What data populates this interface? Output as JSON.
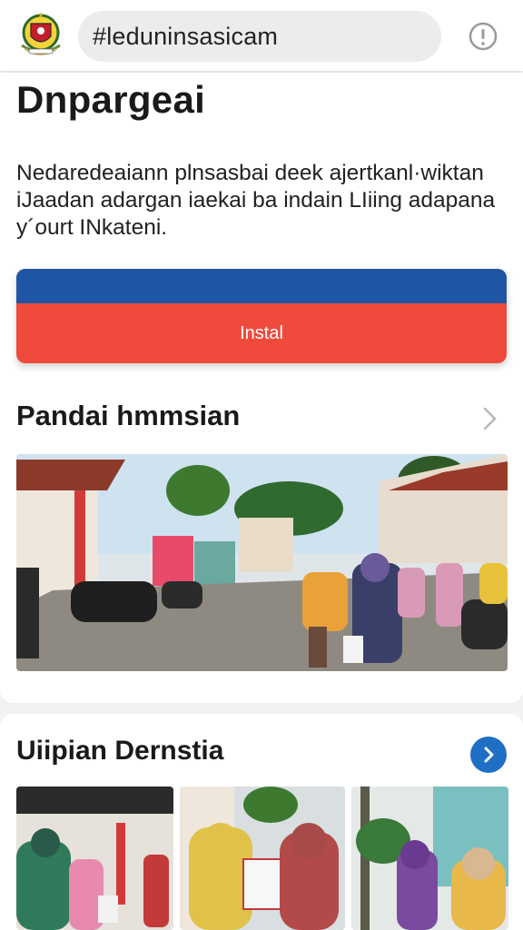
{
  "header": {
    "logo_icon": "emblem-logo-icon",
    "search_value": "#leduninsasicam",
    "info_icon": "info-circle-icon"
  },
  "app": {
    "title": "Dnpargeai",
    "description": "Nedaredeaiann plnsasbai deek ajertkanl·wiktan iJaadan adargan iaekai ba indain LIiing adapana y´ourt INkateni.",
    "install_label": "Instal"
  },
  "section1": {
    "title": "Pandai hmmsian",
    "chevron_icon": "chevron-right-icon"
  },
  "section2": {
    "title": "Uiipian Dernstia",
    "next_icon": "arrow-right-circle-icon"
  },
  "colors": {
    "install_top": "#1f56a3",
    "install_bottom": "#f04a3c",
    "next_button": "#1f6fc4"
  }
}
